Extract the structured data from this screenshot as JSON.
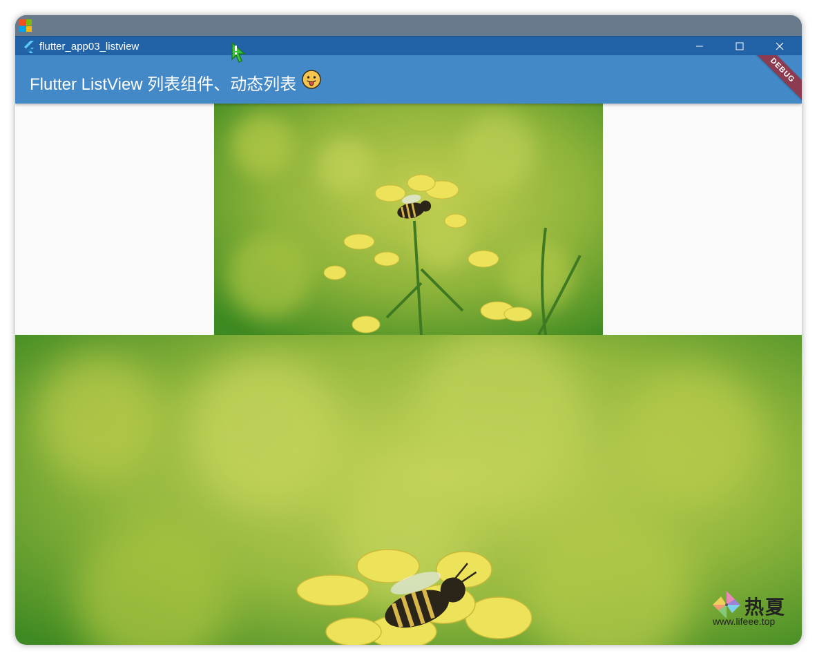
{
  "window": {
    "title": "flutter_app03_listview",
    "minimize_label": "—",
    "maximize_label": "☐",
    "close_label": "✕"
  },
  "appbar": {
    "title": "Flutter ListView 列表组件、动态列表",
    "color": "#4389c7"
  },
  "debug_banner": {
    "label": "DEBUG"
  },
  "list": {
    "items": [
      {
        "type": "image",
        "subject": "bee on yellow rapeseed flower"
      },
      {
        "type": "image",
        "subject": "bee on yellow rapeseed flower"
      }
    ]
  },
  "watermark": {
    "title": "热夏",
    "url": "www.lifeee.top"
  },
  "colors": {
    "host_bar": "#6a7a8d",
    "title_bar": "#2263a8",
    "background": "#fafafa"
  }
}
